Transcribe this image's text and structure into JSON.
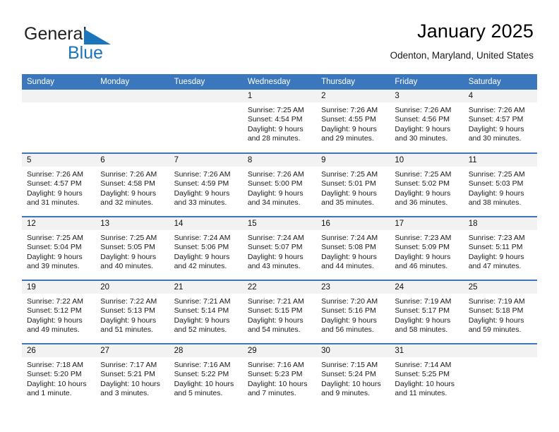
{
  "brand": {
    "name_general": "General",
    "name_blue": "Blue",
    "accent_color": "#1a75bb",
    "text_color": "#231f20"
  },
  "header": {
    "title": "January 2025",
    "location": "Odenton, Maryland, United States"
  },
  "theme": {
    "header_blue": "#3b77bc",
    "daynum_strip": "#f2f2f2",
    "cell_bg": "#ffffff"
  },
  "weekday_headers": [
    "Sunday",
    "Monday",
    "Tuesday",
    "Wednesday",
    "Thursday",
    "Friday",
    "Saturday"
  ],
  "weeks": [
    [
      {
        "day": "",
        "sunrise": "",
        "sunset": "",
        "daylight_line1": "",
        "daylight_line2": ""
      },
      {
        "day": "",
        "sunrise": "",
        "sunset": "",
        "daylight_line1": "",
        "daylight_line2": ""
      },
      {
        "day": "",
        "sunrise": "",
        "sunset": "",
        "daylight_line1": "",
        "daylight_line2": ""
      },
      {
        "day": "1",
        "sunrise": "Sunrise: 7:25 AM",
        "sunset": "Sunset: 4:54 PM",
        "daylight_line1": "Daylight: 9 hours",
        "daylight_line2": "and 28 minutes."
      },
      {
        "day": "2",
        "sunrise": "Sunrise: 7:26 AM",
        "sunset": "Sunset: 4:55 PM",
        "daylight_line1": "Daylight: 9 hours",
        "daylight_line2": "and 29 minutes."
      },
      {
        "day": "3",
        "sunrise": "Sunrise: 7:26 AM",
        "sunset": "Sunset: 4:56 PM",
        "daylight_line1": "Daylight: 9 hours",
        "daylight_line2": "and 30 minutes."
      },
      {
        "day": "4",
        "sunrise": "Sunrise: 7:26 AM",
        "sunset": "Sunset: 4:57 PM",
        "daylight_line1": "Daylight: 9 hours",
        "daylight_line2": "and 30 minutes."
      }
    ],
    [
      {
        "day": "5",
        "sunrise": "Sunrise: 7:26 AM",
        "sunset": "Sunset: 4:57 PM",
        "daylight_line1": "Daylight: 9 hours",
        "daylight_line2": "and 31 minutes."
      },
      {
        "day": "6",
        "sunrise": "Sunrise: 7:26 AM",
        "sunset": "Sunset: 4:58 PM",
        "daylight_line1": "Daylight: 9 hours",
        "daylight_line2": "and 32 minutes."
      },
      {
        "day": "7",
        "sunrise": "Sunrise: 7:26 AM",
        "sunset": "Sunset: 4:59 PM",
        "daylight_line1": "Daylight: 9 hours",
        "daylight_line2": "and 33 minutes."
      },
      {
        "day": "8",
        "sunrise": "Sunrise: 7:26 AM",
        "sunset": "Sunset: 5:00 PM",
        "daylight_line1": "Daylight: 9 hours",
        "daylight_line2": "and 34 minutes."
      },
      {
        "day": "9",
        "sunrise": "Sunrise: 7:25 AM",
        "sunset": "Sunset: 5:01 PM",
        "daylight_line1": "Daylight: 9 hours",
        "daylight_line2": "and 35 minutes."
      },
      {
        "day": "10",
        "sunrise": "Sunrise: 7:25 AM",
        "sunset": "Sunset: 5:02 PM",
        "daylight_line1": "Daylight: 9 hours",
        "daylight_line2": "and 36 minutes."
      },
      {
        "day": "11",
        "sunrise": "Sunrise: 7:25 AM",
        "sunset": "Sunset: 5:03 PM",
        "daylight_line1": "Daylight: 9 hours",
        "daylight_line2": "and 38 minutes."
      }
    ],
    [
      {
        "day": "12",
        "sunrise": "Sunrise: 7:25 AM",
        "sunset": "Sunset: 5:04 PM",
        "daylight_line1": "Daylight: 9 hours",
        "daylight_line2": "and 39 minutes."
      },
      {
        "day": "13",
        "sunrise": "Sunrise: 7:25 AM",
        "sunset": "Sunset: 5:05 PM",
        "daylight_line1": "Daylight: 9 hours",
        "daylight_line2": "and 40 minutes."
      },
      {
        "day": "14",
        "sunrise": "Sunrise: 7:24 AM",
        "sunset": "Sunset: 5:06 PM",
        "daylight_line1": "Daylight: 9 hours",
        "daylight_line2": "and 42 minutes."
      },
      {
        "day": "15",
        "sunrise": "Sunrise: 7:24 AM",
        "sunset": "Sunset: 5:07 PM",
        "daylight_line1": "Daylight: 9 hours",
        "daylight_line2": "and 43 minutes."
      },
      {
        "day": "16",
        "sunrise": "Sunrise: 7:24 AM",
        "sunset": "Sunset: 5:08 PM",
        "daylight_line1": "Daylight: 9 hours",
        "daylight_line2": "and 44 minutes."
      },
      {
        "day": "17",
        "sunrise": "Sunrise: 7:23 AM",
        "sunset": "Sunset: 5:09 PM",
        "daylight_line1": "Daylight: 9 hours",
        "daylight_line2": "and 46 minutes."
      },
      {
        "day": "18",
        "sunrise": "Sunrise: 7:23 AM",
        "sunset": "Sunset: 5:11 PM",
        "daylight_line1": "Daylight: 9 hours",
        "daylight_line2": "and 47 minutes."
      }
    ],
    [
      {
        "day": "19",
        "sunrise": "Sunrise: 7:22 AM",
        "sunset": "Sunset: 5:12 PM",
        "daylight_line1": "Daylight: 9 hours",
        "daylight_line2": "and 49 minutes."
      },
      {
        "day": "20",
        "sunrise": "Sunrise: 7:22 AM",
        "sunset": "Sunset: 5:13 PM",
        "daylight_line1": "Daylight: 9 hours",
        "daylight_line2": "and 51 minutes."
      },
      {
        "day": "21",
        "sunrise": "Sunrise: 7:21 AM",
        "sunset": "Sunset: 5:14 PM",
        "daylight_line1": "Daylight: 9 hours",
        "daylight_line2": "and 52 minutes."
      },
      {
        "day": "22",
        "sunrise": "Sunrise: 7:21 AM",
        "sunset": "Sunset: 5:15 PM",
        "daylight_line1": "Daylight: 9 hours",
        "daylight_line2": "and 54 minutes."
      },
      {
        "day": "23",
        "sunrise": "Sunrise: 7:20 AM",
        "sunset": "Sunset: 5:16 PM",
        "daylight_line1": "Daylight: 9 hours",
        "daylight_line2": "and 56 minutes."
      },
      {
        "day": "24",
        "sunrise": "Sunrise: 7:19 AM",
        "sunset": "Sunset: 5:17 PM",
        "daylight_line1": "Daylight: 9 hours",
        "daylight_line2": "and 58 minutes."
      },
      {
        "day": "25",
        "sunrise": "Sunrise: 7:19 AM",
        "sunset": "Sunset: 5:18 PM",
        "daylight_line1": "Daylight: 9 hours",
        "daylight_line2": "and 59 minutes."
      }
    ],
    [
      {
        "day": "26",
        "sunrise": "Sunrise: 7:18 AM",
        "sunset": "Sunset: 5:20 PM",
        "daylight_line1": "Daylight: 10 hours",
        "daylight_line2": "and 1 minute."
      },
      {
        "day": "27",
        "sunrise": "Sunrise: 7:17 AM",
        "sunset": "Sunset: 5:21 PM",
        "daylight_line1": "Daylight: 10 hours",
        "daylight_line2": "and 3 minutes."
      },
      {
        "day": "28",
        "sunrise": "Sunrise: 7:16 AM",
        "sunset": "Sunset: 5:22 PM",
        "daylight_line1": "Daylight: 10 hours",
        "daylight_line2": "and 5 minutes."
      },
      {
        "day": "29",
        "sunrise": "Sunrise: 7:16 AM",
        "sunset": "Sunset: 5:23 PM",
        "daylight_line1": "Daylight: 10 hours",
        "daylight_line2": "and 7 minutes."
      },
      {
        "day": "30",
        "sunrise": "Sunrise: 7:15 AM",
        "sunset": "Sunset: 5:24 PM",
        "daylight_line1": "Daylight: 10 hours",
        "daylight_line2": "and 9 minutes."
      },
      {
        "day": "31",
        "sunrise": "Sunrise: 7:14 AM",
        "sunset": "Sunset: 5:25 PM",
        "daylight_line1": "Daylight: 10 hours",
        "daylight_line2": "and 11 minutes."
      },
      {
        "day": "",
        "sunrise": "",
        "sunset": "",
        "daylight_line1": "",
        "daylight_line2": ""
      }
    ]
  ]
}
